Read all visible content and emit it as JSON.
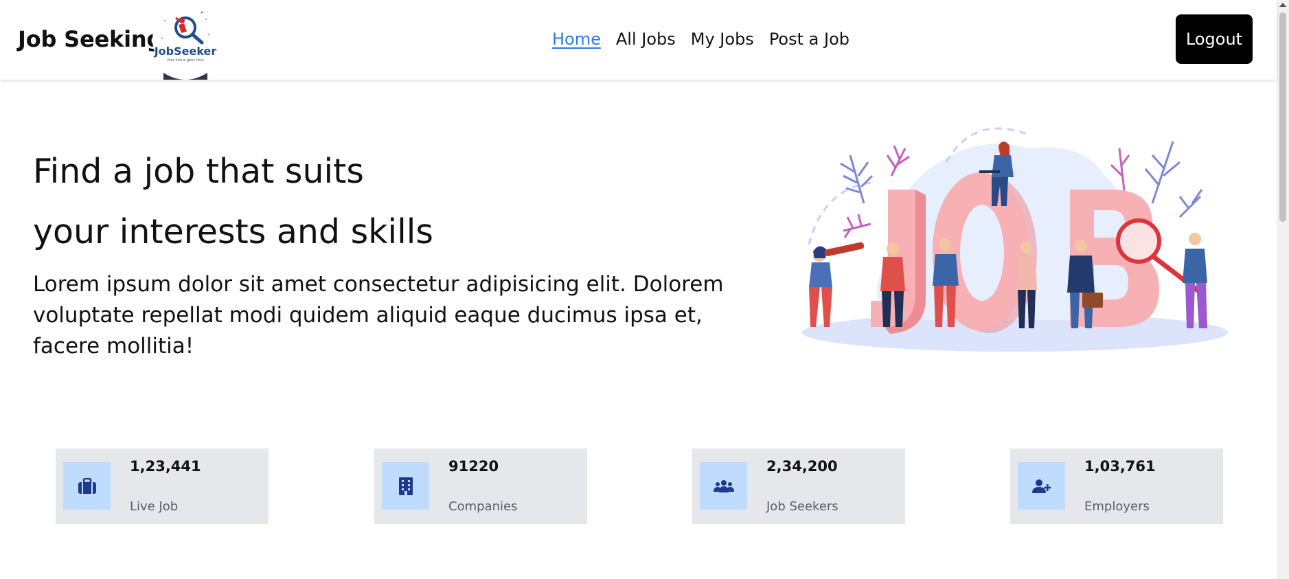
{
  "navbar": {
    "brand": "Job Seeking",
    "logo_text": "JobSeeker",
    "logo_tagline": "Your future goes here",
    "links": [
      {
        "label": "Home",
        "active": true
      },
      {
        "label": "All Jobs",
        "active": false
      },
      {
        "label": "My Jobs",
        "active": false
      },
      {
        "label": "Post a Job",
        "active": false
      }
    ],
    "logout_label": "Logout"
  },
  "hero": {
    "title_line1": "Find a job that suits",
    "title_line2": "your interests and skills",
    "description": "Lorem ipsum dolor sit amet consectetur adipisicing elit. Dolorem voluptate repellat modi quidem aliquid eaque ducimus ipsa et, facere mollitia!",
    "illustration_word": "JOB"
  },
  "stats": [
    {
      "value": "1,23,441",
      "label": "Live Job",
      "icon": "briefcase-icon"
    },
    {
      "value": "91220",
      "label": "Companies",
      "icon": "building-icon"
    },
    {
      "value": "2,34,200",
      "label": "Job Seekers",
      "icon": "users-icon"
    },
    {
      "value": "1,03,761",
      "label": "Employers",
      "icon": "user-plus-icon"
    }
  ],
  "colors": {
    "accent": "#2f7de0",
    "icon_blue": "#1e3a8a",
    "card_bg": "#e5e7eb",
    "icon_bg": "#bfdbfe",
    "job_pink": "#f8a8ad"
  }
}
